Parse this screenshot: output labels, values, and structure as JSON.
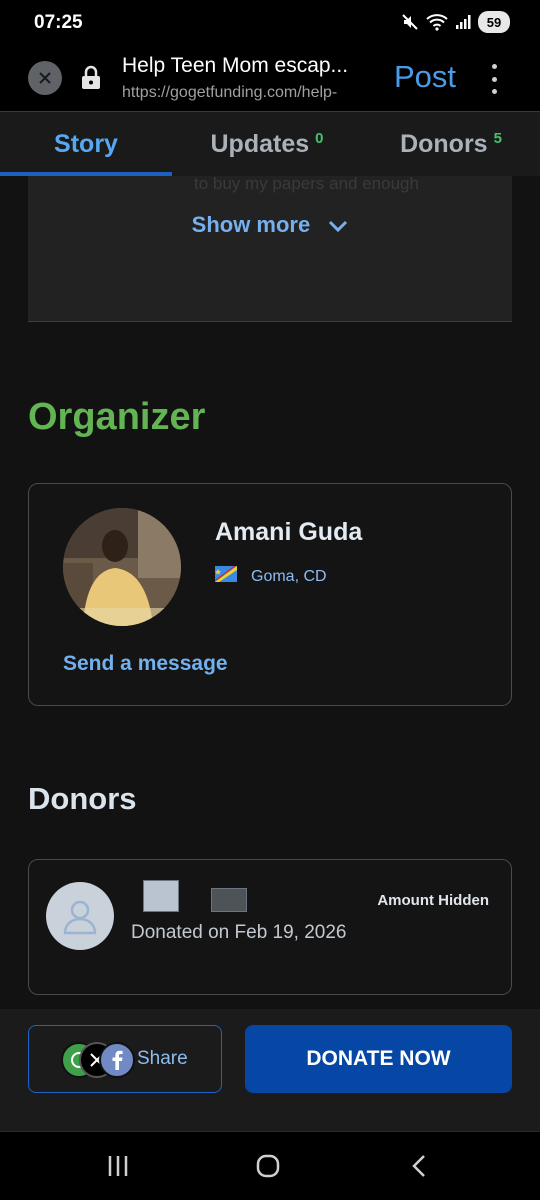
{
  "status_bar": {
    "time": "07:25",
    "battery": "59"
  },
  "browser": {
    "title": "Help Teen Mom escap...",
    "url": "https://gogetfunding.com/help-",
    "post_label": "Post"
  },
  "tabs": [
    {
      "label": "Story",
      "count": ""
    },
    {
      "label": "Updates",
      "count": "0"
    },
    {
      "label": "Donors",
      "count": "5"
    }
  ],
  "story": {
    "faded_text": "to buy my papers and enough",
    "show_more_label": "Show more"
  },
  "organizer": {
    "heading": "Organizer",
    "name": "Amani Guda",
    "location": "Goma, CD",
    "send_message_label": "Send a message"
  },
  "donors": {
    "heading": "Donors",
    "items": [
      {
        "donated_on": "Donated on Feb 19, 2026",
        "amount": "Amount Hidden"
      }
    ]
  },
  "actions": {
    "share_label": "Share",
    "donate_label": "DONATE NOW"
  },
  "colors": {
    "accent": "#4a9be8",
    "organizer_heading": "#62b552",
    "donate_button": "#0646a5"
  }
}
